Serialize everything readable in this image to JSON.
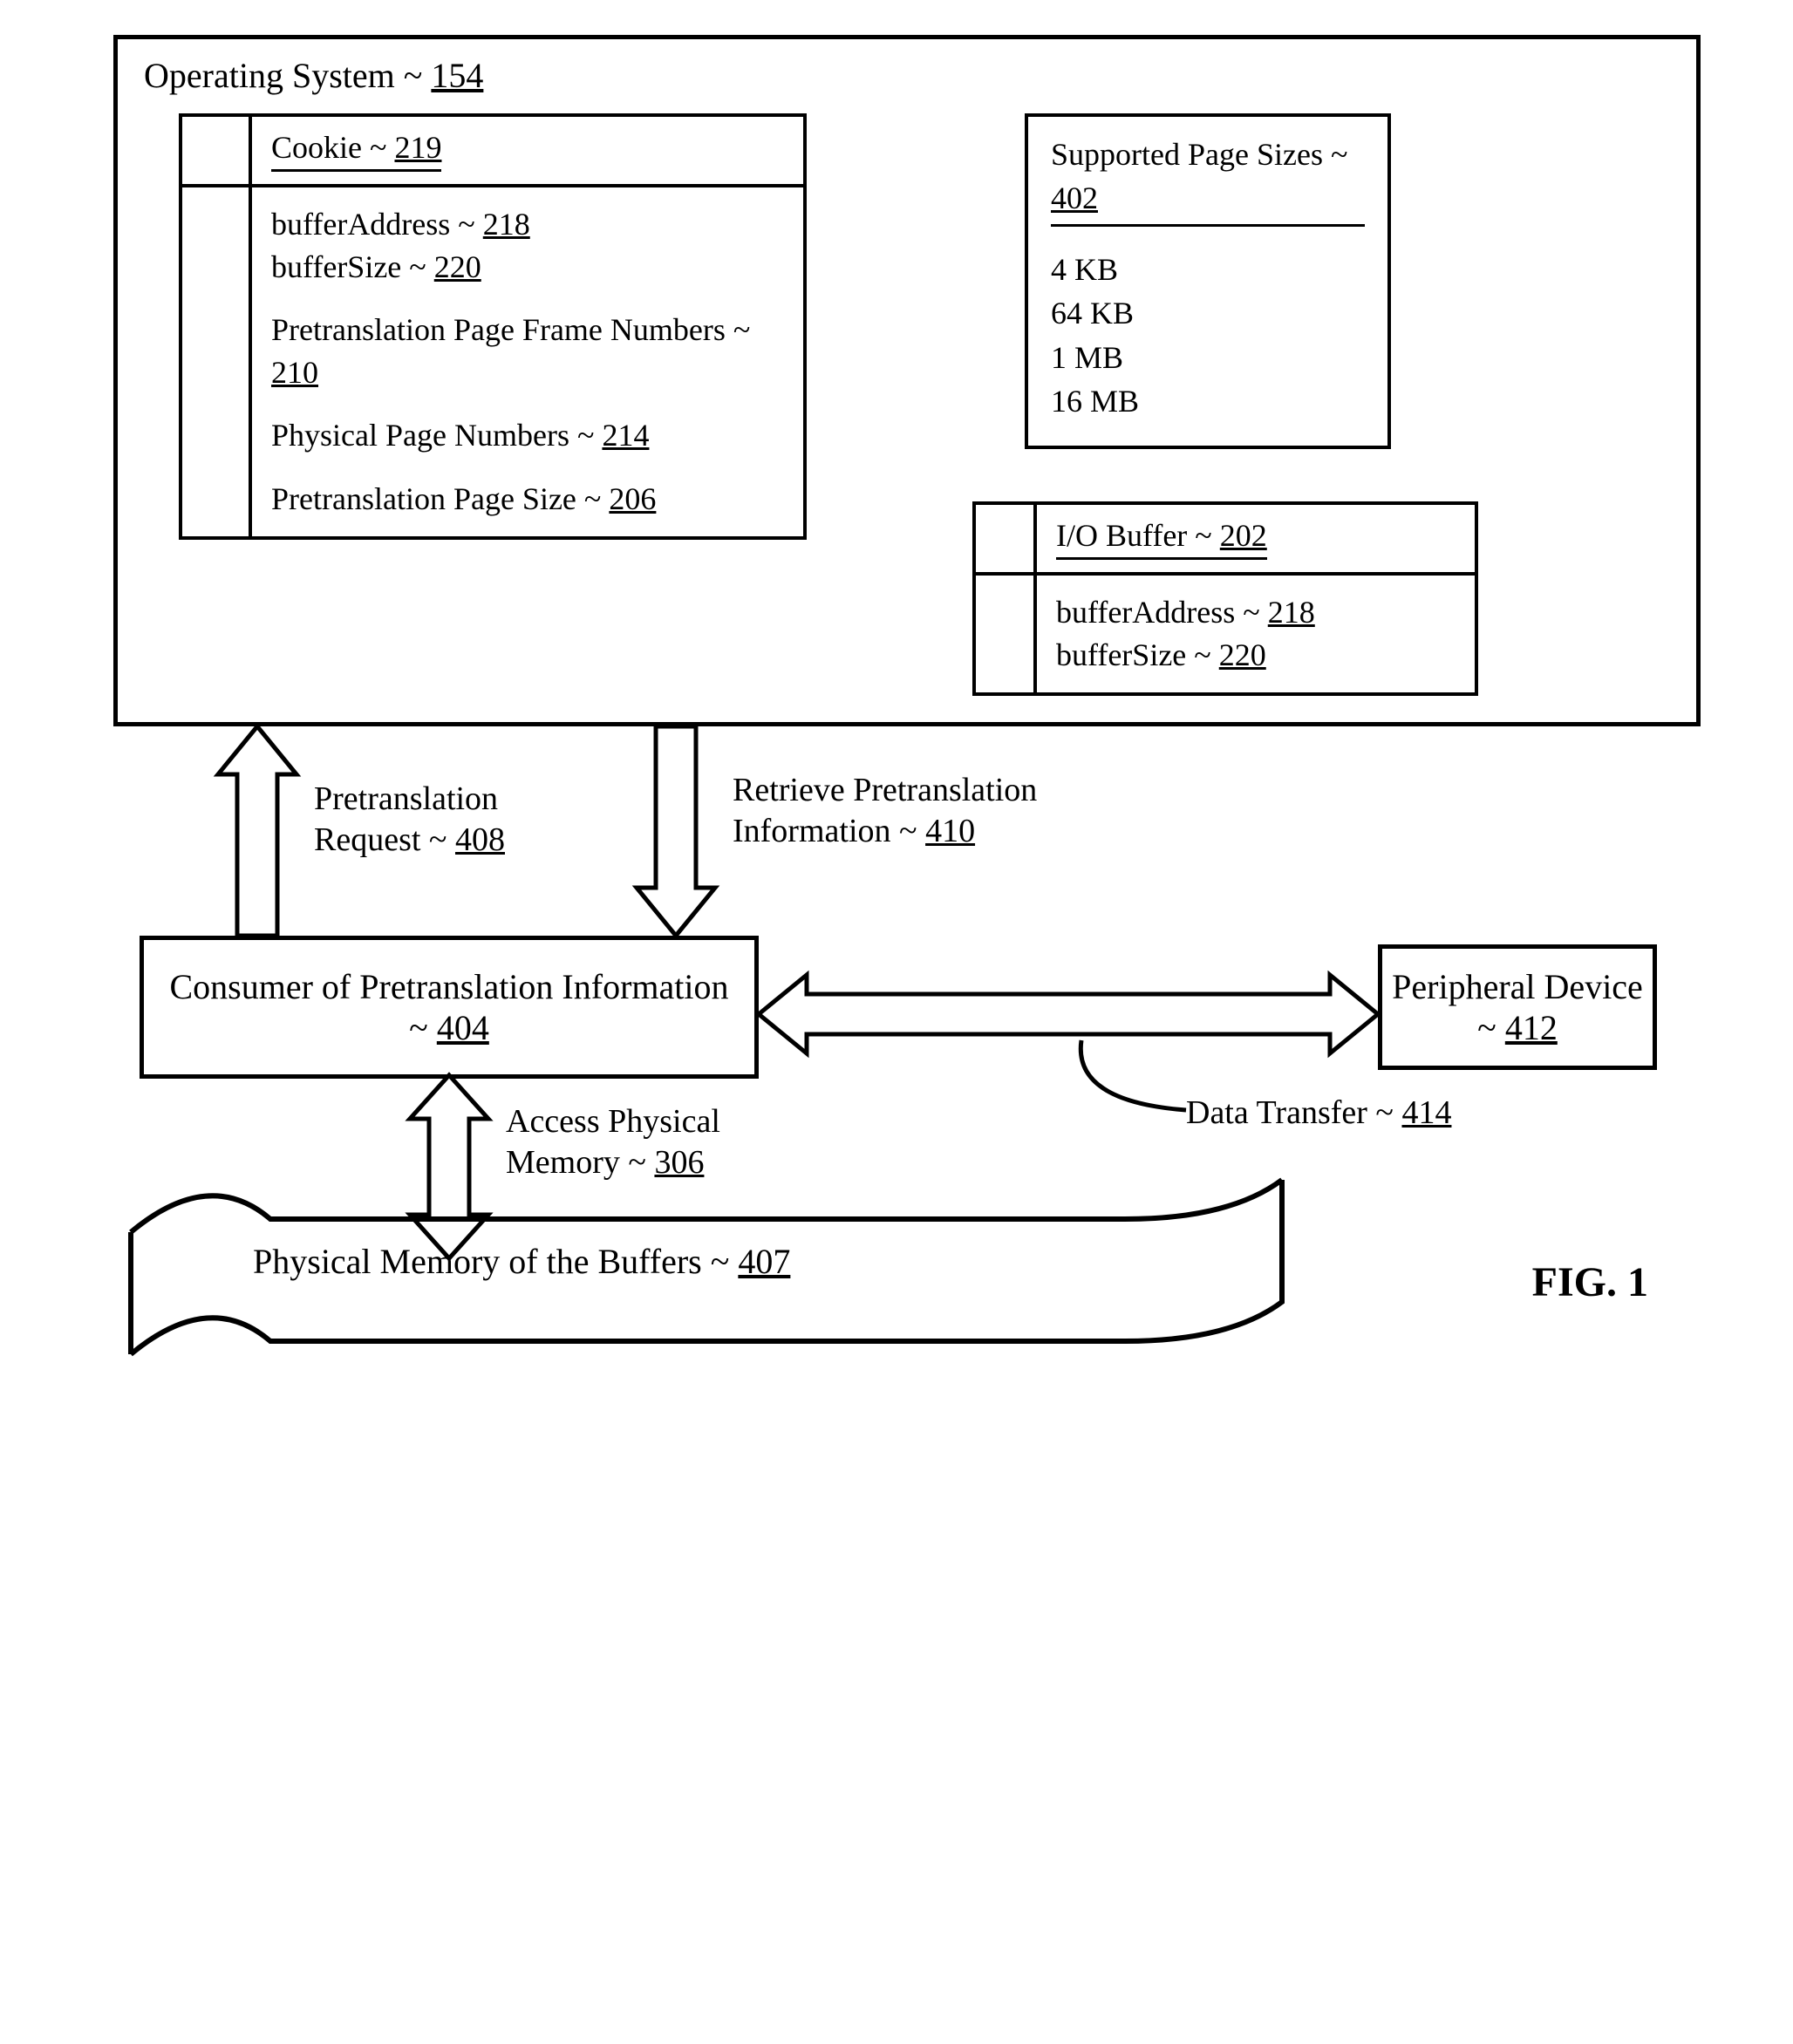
{
  "os": {
    "title_text": "Operating System ~ ",
    "title_ref": "154",
    "cookie": {
      "heading_text": "Cookie ~ ",
      "heading_ref": "219",
      "items": [
        {
          "text": "bufferAddress ~ ",
          "ref": "218"
        },
        {
          "text": "bufferSize ~ ",
          "ref": "220"
        },
        {
          "text": "Pretranslation Page Frame Numbers ~ ",
          "ref": "210"
        },
        {
          "text": "Physical Page Numbers ~ ",
          "ref": "214"
        },
        {
          "text": "Pretranslation Page Size ~ ",
          "ref": "206"
        }
      ]
    },
    "page_sizes": {
      "heading_text": "Supported Page Sizes ~ ",
      "heading_ref": "402",
      "values": [
        "4 KB",
        "64 KB",
        "1 MB",
        "16 MB"
      ]
    },
    "io_buffer": {
      "heading_text": "I/O Buffer ~ ",
      "heading_ref": "202",
      "items": [
        {
          "text": "bufferAddress ~ ",
          "ref": "218"
        },
        {
          "text": "bufferSize ~ ",
          "ref": "220"
        }
      ]
    }
  },
  "arrows": {
    "pretrans_req": {
      "text": "Pretranslation Request ~ ",
      "ref": "408"
    },
    "retrieve": {
      "text": "Retrieve Pretranslation Information ~ ",
      "ref": "410"
    },
    "access_mem": {
      "text": "Access Physical Memory ~ ",
      "ref": "306"
    },
    "data_transfer": {
      "text": "Data Transfer ~ ",
      "ref": "414"
    }
  },
  "consumer": {
    "text": "Consumer of Pretranslation Information ~ ",
    "ref": "404"
  },
  "peripheral": {
    "text": "Peripheral Device ~ ",
    "ref": "412"
  },
  "phys_mem": {
    "text": "Physical Memory of the Buffers ~ ",
    "ref": "407"
  },
  "figure_label": "FIG. 1"
}
